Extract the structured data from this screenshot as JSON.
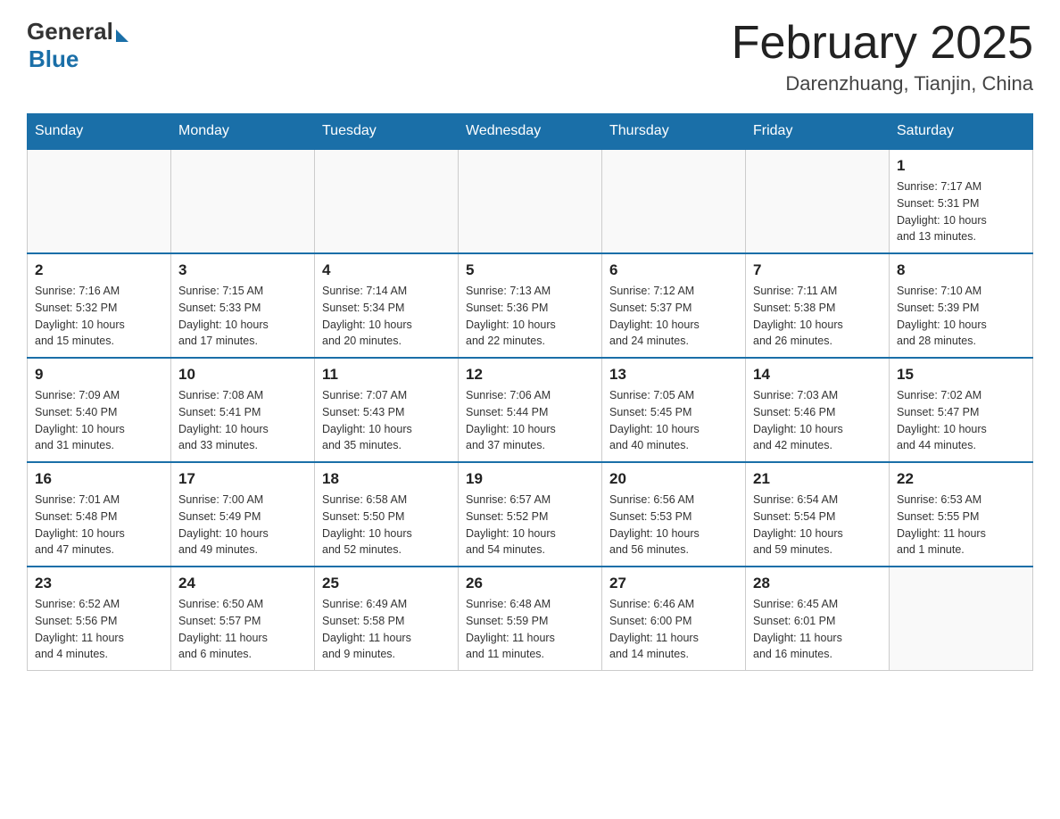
{
  "header": {
    "logo_general": "General",
    "logo_blue": "Blue",
    "month_title": "February 2025",
    "location": "Darenzhuang, Tianjin, China"
  },
  "days_of_week": [
    "Sunday",
    "Monday",
    "Tuesday",
    "Wednesday",
    "Thursday",
    "Friday",
    "Saturday"
  ],
  "weeks": [
    [
      {
        "day": "",
        "info": ""
      },
      {
        "day": "",
        "info": ""
      },
      {
        "day": "",
        "info": ""
      },
      {
        "day": "",
        "info": ""
      },
      {
        "day": "",
        "info": ""
      },
      {
        "day": "",
        "info": ""
      },
      {
        "day": "1",
        "info": "Sunrise: 7:17 AM\nSunset: 5:31 PM\nDaylight: 10 hours\nand 13 minutes."
      }
    ],
    [
      {
        "day": "2",
        "info": "Sunrise: 7:16 AM\nSunset: 5:32 PM\nDaylight: 10 hours\nand 15 minutes."
      },
      {
        "day": "3",
        "info": "Sunrise: 7:15 AM\nSunset: 5:33 PM\nDaylight: 10 hours\nand 17 minutes."
      },
      {
        "day": "4",
        "info": "Sunrise: 7:14 AM\nSunset: 5:34 PM\nDaylight: 10 hours\nand 20 minutes."
      },
      {
        "day": "5",
        "info": "Sunrise: 7:13 AM\nSunset: 5:36 PM\nDaylight: 10 hours\nand 22 minutes."
      },
      {
        "day": "6",
        "info": "Sunrise: 7:12 AM\nSunset: 5:37 PM\nDaylight: 10 hours\nand 24 minutes."
      },
      {
        "day": "7",
        "info": "Sunrise: 7:11 AM\nSunset: 5:38 PM\nDaylight: 10 hours\nand 26 minutes."
      },
      {
        "day": "8",
        "info": "Sunrise: 7:10 AM\nSunset: 5:39 PM\nDaylight: 10 hours\nand 28 minutes."
      }
    ],
    [
      {
        "day": "9",
        "info": "Sunrise: 7:09 AM\nSunset: 5:40 PM\nDaylight: 10 hours\nand 31 minutes."
      },
      {
        "day": "10",
        "info": "Sunrise: 7:08 AM\nSunset: 5:41 PM\nDaylight: 10 hours\nand 33 minutes."
      },
      {
        "day": "11",
        "info": "Sunrise: 7:07 AM\nSunset: 5:43 PM\nDaylight: 10 hours\nand 35 minutes."
      },
      {
        "day": "12",
        "info": "Sunrise: 7:06 AM\nSunset: 5:44 PM\nDaylight: 10 hours\nand 37 minutes."
      },
      {
        "day": "13",
        "info": "Sunrise: 7:05 AM\nSunset: 5:45 PM\nDaylight: 10 hours\nand 40 minutes."
      },
      {
        "day": "14",
        "info": "Sunrise: 7:03 AM\nSunset: 5:46 PM\nDaylight: 10 hours\nand 42 minutes."
      },
      {
        "day": "15",
        "info": "Sunrise: 7:02 AM\nSunset: 5:47 PM\nDaylight: 10 hours\nand 44 minutes."
      }
    ],
    [
      {
        "day": "16",
        "info": "Sunrise: 7:01 AM\nSunset: 5:48 PM\nDaylight: 10 hours\nand 47 minutes."
      },
      {
        "day": "17",
        "info": "Sunrise: 7:00 AM\nSunset: 5:49 PM\nDaylight: 10 hours\nand 49 minutes."
      },
      {
        "day": "18",
        "info": "Sunrise: 6:58 AM\nSunset: 5:50 PM\nDaylight: 10 hours\nand 52 minutes."
      },
      {
        "day": "19",
        "info": "Sunrise: 6:57 AM\nSunset: 5:52 PM\nDaylight: 10 hours\nand 54 minutes."
      },
      {
        "day": "20",
        "info": "Sunrise: 6:56 AM\nSunset: 5:53 PM\nDaylight: 10 hours\nand 56 minutes."
      },
      {
        "day": "21",
        "info": "Sunrise: 6:54 AM\nSunset: 5:54 PM\nDaylight: 10 hours\nand 59 minutes."
      },
      {
        "day": "22",
        "info": "Sunrise: 6:53 AM\nSunset: 5:55 PM\nDaylight: 11 hours\nand 1 minute."
      }
    ],
    [
      {
        "day": "23",
        "info": "Sunrise: 6:52 AM\nSunset: 5:56 PM\nDaylight: 11 hours\nand 4 minutes."
      },
      {
        "day": "24",
        "info": "Sunrise: 6:50 AM\nSunset: 5:57 PM\nDaylight: 11 hours\nand 6 minutes."
      },
      {
        "day": "25",
        "info": "Sunrise: 6:49 AM\nSunset: 5:58 PM\nDaylight: 11 hours\nand 9 minutes."
      },
      {
        "day": "26",
        "info": "Sunrise: 6:48 AM\nSunset: 5:59 PM\nDaylight: 11 hours\nand 11 minutes."
      },
      {
        "day": "27",
        "info": "Sunrise: 6:46 AM\nSunset: 6:00 PM\nDaylight: 11 hours\nand 14 minutes."
      },
      {
        "day": "28",
        "info": "Sunrise: 6:45 AM\nSunset: 6:01 PM\nDaylight: 11 hours\nand 16 minutes."
      },
      {
        "day": "",
        "info": ""
      }
    ]
  ]
}
